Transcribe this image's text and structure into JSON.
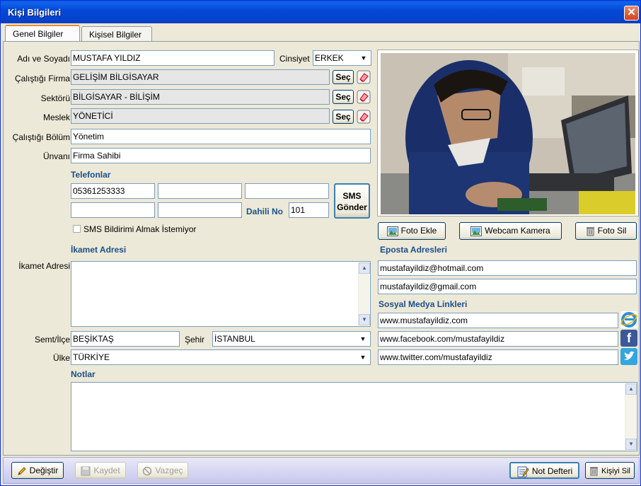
{
  "window": {
    "title": "Kişi Bilgileri"
  },
  "tabs": [
    {
      "label": "Genel Bilgiler"
    },
    {
      "label": "Kişisel Bilgiler"
    }
  ],
  "form": {
    "name_label": "Adı ve Soyadı",
    "name_value": "MUSTAFA YILDIZ",
    "gender_label": "Cinsiyet",
    "gender_value": "ERKEK",
    "company_label": "Çalıştığı Firma",
    "company_value": "GELİŞİM BİLGİSAYAR",
    "sector_label": "Sektörü",
    "sector_value": "BİLGİSAYAR - BİLİŞİM",
    "job_label": "Meslek",
    "job_value": "YÖNETİCİ",
    "dept_label": "Çalıştığı Bölüm",
    "dept_value": "Yönetim",
    "title_label": "Ünvanı",
    "title_value": "Firma Sahibi",
    "select_button": "Seç"
  },
  "phones": {
    "section": "Telefonlar",
    "phone1": "05361253333",
    "phone2": "",
    "phone3": "",
    "phone4": "",
    "phone5": "",
    "ext_label": "Dahili No",
    "ext_value": "101",
    "sms_button_line1": "SMS",
    "sms_button_line2": "Gönder",
    "sms_optout": "SMS Bildirimi Almak İstemiyor"
  },
  "address": {
    "section": "İkamet Adresi",
    "label": "İkamet Adresi",
    "value": "",
    "district_label": "Semt/İlçe",
    "district_value": "BEŞİKTAŞ",
    "city_label": "Şehir",
    "city_value": "İSTANBUL",
    "country_label": "Ülke",
    "country_value": "TÜRKİYE"
  },
  "notes": {
    "section": "Notlar",
    "value": ""
  },
  "photo_buttons": {
    "add": "Foto Ekle",
    "webcam": "Webcam Kamera",
    "delete": "Foto Sil"
  },
  "emails": {
    "section": "Eposta Adresleri",
    "email1": "mustafayildiz@hotmail.com",
    "email2": "mustafayildiz@gmail.com"
  },
  "social": {
    "section": "Sosyal Medya Linkleri",
    "web": "www.mustafayildiz.com",
    "facebook": "www.facebook.com/mustafayildiz",
    "twitter": "www.twitter.com/mustafayildiz"
  },
  "footer": {
    "edit": "Değiştir",
    "save": "Kaydet",
    "cancel": "Vazgeç",
    "notebook": "Not Defteri",
    "delete_person": "Kişiyi Sil"
  },
  "colors": {
    "section_title": "#1d4e89",
    "titlebar": "#0549d8",
    "accent_tab": "#e68b2c"
  }
}
